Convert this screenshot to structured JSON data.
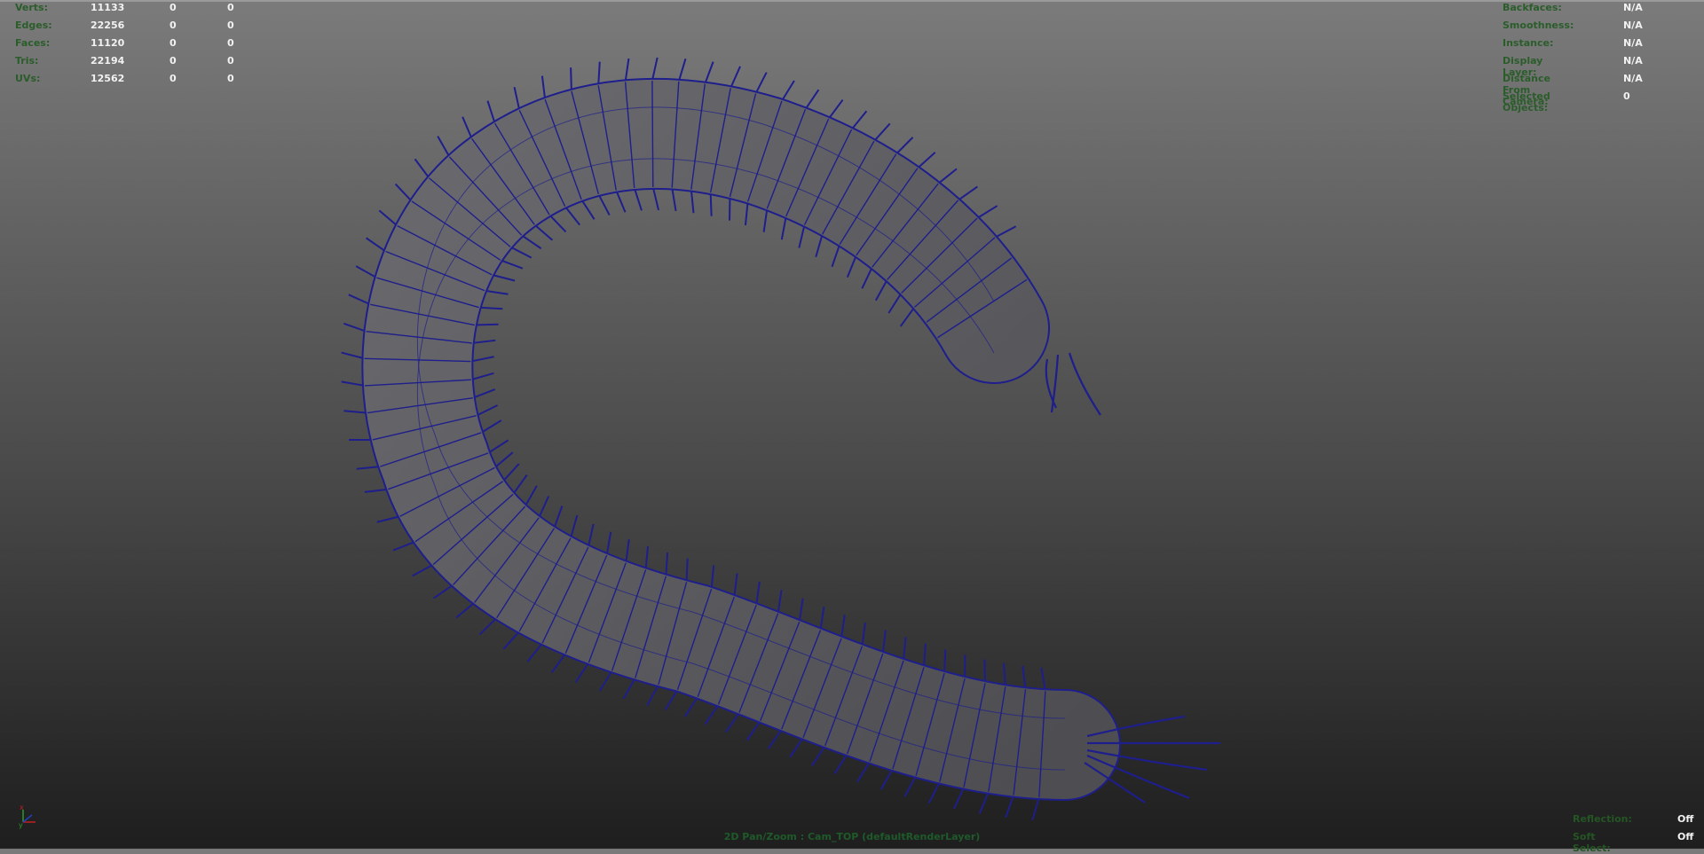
{
  "hud_left": {
    "rows": [
      {
        "label": "Verts:",
        "v1": "11133",
        "v2": "0",
        "v3": "0"
      },
      {
        "label": "Edges:",
        "v1": "22256",
        "v2": "0",
        "v3": "0"
      },
      {
        "label": "Faces:",
        "v1": "11120",
        "v2": "0",
        "v3": "0"
      },
      {
        "label": "Tris:",
        "v1": "22194",
        "v2": "0",
        "v3": "0"
      },
      {
        "label": "UVs:",
        "v1": "12562",
        "v2": "0",
        "v3": "0"
      }
    ]
  },
  "hud_right": {
    "rows": [
      {
        "label": "Backfaces:",
        "value": "N/A"
      },
      {
        "label": "Smoothness:",
        "value": "N/A"
      },
      {
        "label": "Instance:",
        "value": "N/A"
      },
      {
        "label": "Display Layer:",
        "value": "N/A"
      },
      {
        "label": "Distance From Camera:",
        "value": "N/A"
      },
      {
        "label": "Selected Objects:",
        "value": "0"
      }
    ]
  },
  "hud_bottom_right": {
    "rows": [
      {
        "label": "Reflection:",
        "value": "Off"
      },
      {
        "label": "Soft Select:",
        "value": "Off"
      }
    ]
  },
  "status_bar": "2D Pan/Zoom : Cam_TOP (defaultRenderLayer)",
  "axis_gizmo": {
    "x_label": "x",
    "y_label": "y"
  },
  "colors": {
    "wireframe": "#1e1e8c",
    "hud_label": "#2b5d2b",
    "hud_value": "#f2f2f2",
    "mesh_fill": "#5e5e62"
  },
  "viewport": {
    "model_name": "centipede-mesh-icon"
  }
}
